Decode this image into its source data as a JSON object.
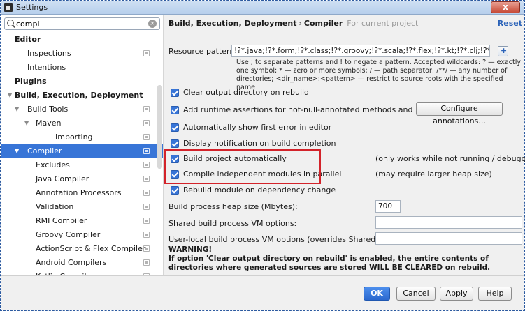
{
  "window": {
    "title": "Settings",
    "close_label": "x"
  },
  "search": {
    "value": "compi",
    "clear_label": "×"
  },
  "tree": [
    {
      "label": "Editor",
      "bold": true,
      "level": 1,
      "arrow": "",
      "proj": false
    },
    {
      "label": "Inspections",
      "bold": false,
      "level": 2,
      "arrow": "",
      "proj": true
    },
    {
      "label": "Intentions",
      "bold": false,
      "level": 2,
      "arrow": "",
      "proj": false
    },
    {
      "label": "Plugins",
      "bold": true,
      "level": 1,
      "arrow": "",
      "proj": false
    },
    {
      "label": "Build, Execution, Deployment",
      "bold": true,
      "level": 1,
      "arrow": "▼",
      "proj": false
    },
    {
      "label": "Build Tools",
      "bold": false,
      "level": 2,
      "arrow": "▼",
      "proj": true
    },
    {
      "label": "Maven",
      "bold": false,
      "level": 3,
      "arrow": "▼",
      "proj": true
    },
    {
      "label": "Importing",
      "bold": false,
      "level": 4,
      "arrow": "",
      "proj": true
    },
    {
      "label": "Compiler",
      "bold": false,
      "level": 2,
      "arrow": "▼",
      "proj": true,
      "selected": true
    },
    {
      "label": "Excludes",
      "bold": false,
      "level": 3,
      "arrow": "",
      "proj": true
    },
    {
      "label": "Java Compiler",
      "bold": false,
      "level": 3,
      "arrow": "",
      "proj": true
    },
    {
      "label": "Annotation Processors",
      "bold": false,
      "level": 3,
      "arrow": "",
      "proj": true
    },
    {
      "label": "Validation",
      "bold": false,
      "level": 3,
      "arrow": "",
      "proj": true
    },
    {
      "label": "RMI Compiler",
      "bold": false,
      "level": 3,
      "arrow": "",
      "proj": true
    },
    {
      "label": "Groovy Compiler",
      "bold": false,
      "level": 3,
      "arrow": "",
      "proj": true
    },
    {
      "label": "ActionScript & Flex Compiler",
      "bold": false,
      "level": 3,
      "arrow": "",
      "proj": true
    },
    {
      "label": "Android Compilers",
      "bold": false,
      "level": 3,
      "arrow": "",
      "proj": true
    },
    {
      "label": "Kotlin Compiler",
      "bold": false,
      "level": 3,
      "arrow": "",
      "proj": true
    }
  ],
  "header": {
    "crumb1": "Build, Execution, Deployment",
    "sep": "›",
    "crumb2": "Compiler",
    "hint": "For current project",
    "reset": "Reset"
  },
  "resource": {
    "label": "Resource patterns:",
    "value": "!?*.java;!?*.form;!?*.class;!?*.groovy;!?*.scala;!?*.flex;!?*.kt;!?*.clj;!?*.aj",
    "help": "Use ; to separate patterns and ! to negate a pattern. Accepted wildcards: ? — exactly one symbol; * — zero or more symbols; / — path separator; /**/ — any number of directories; <dir_name>:<pattern> — restrict to source roots with the specified name"
  },
  "options": {
    "clear_output": "Clear output directory on rebuild",
    "runtime_assertions": "Add runtime assertions for not-null-annotated methods and parameters",
    "configure_annotations": "Configure annotations...",
    "show_first_error": "Automatically show first error in editor",
    "display_notification": "Display notification on build completion",
    "build_auto": "Build project automatically",
    "build_auto_note": "(only works while not running / debugging)",
    "compile_parallel": "Compile independent modules in parallel",
    "compile_parallel_note": "(may require larger heap size)",
    "rebuild_module": "Rebuild module on dependency change"
  },
  "heap": {
    "label": "Build process heap size (Mbytes):",
    "value": "700"
  },
  "shared_vm": {
    "label": "Shared build process VM options:",
    "value": ""
  },
  "user_vm": {
    "label": "User-local build process VM options (overrides Shared options):",
    "value": ""
  },
  "warning": {
    "title": "WARNING!",
    "text": "If option 'Clear output directory on rebuild' is enabled, the entire contents of directories where generated sources are stored WILL BE CLEARED on rebuild."
  },
  "buttons": {
    "ok": "OK",
    "cancel": "Cancel",
    "apply": "Apply",
    "help": "Help"
  }
}
